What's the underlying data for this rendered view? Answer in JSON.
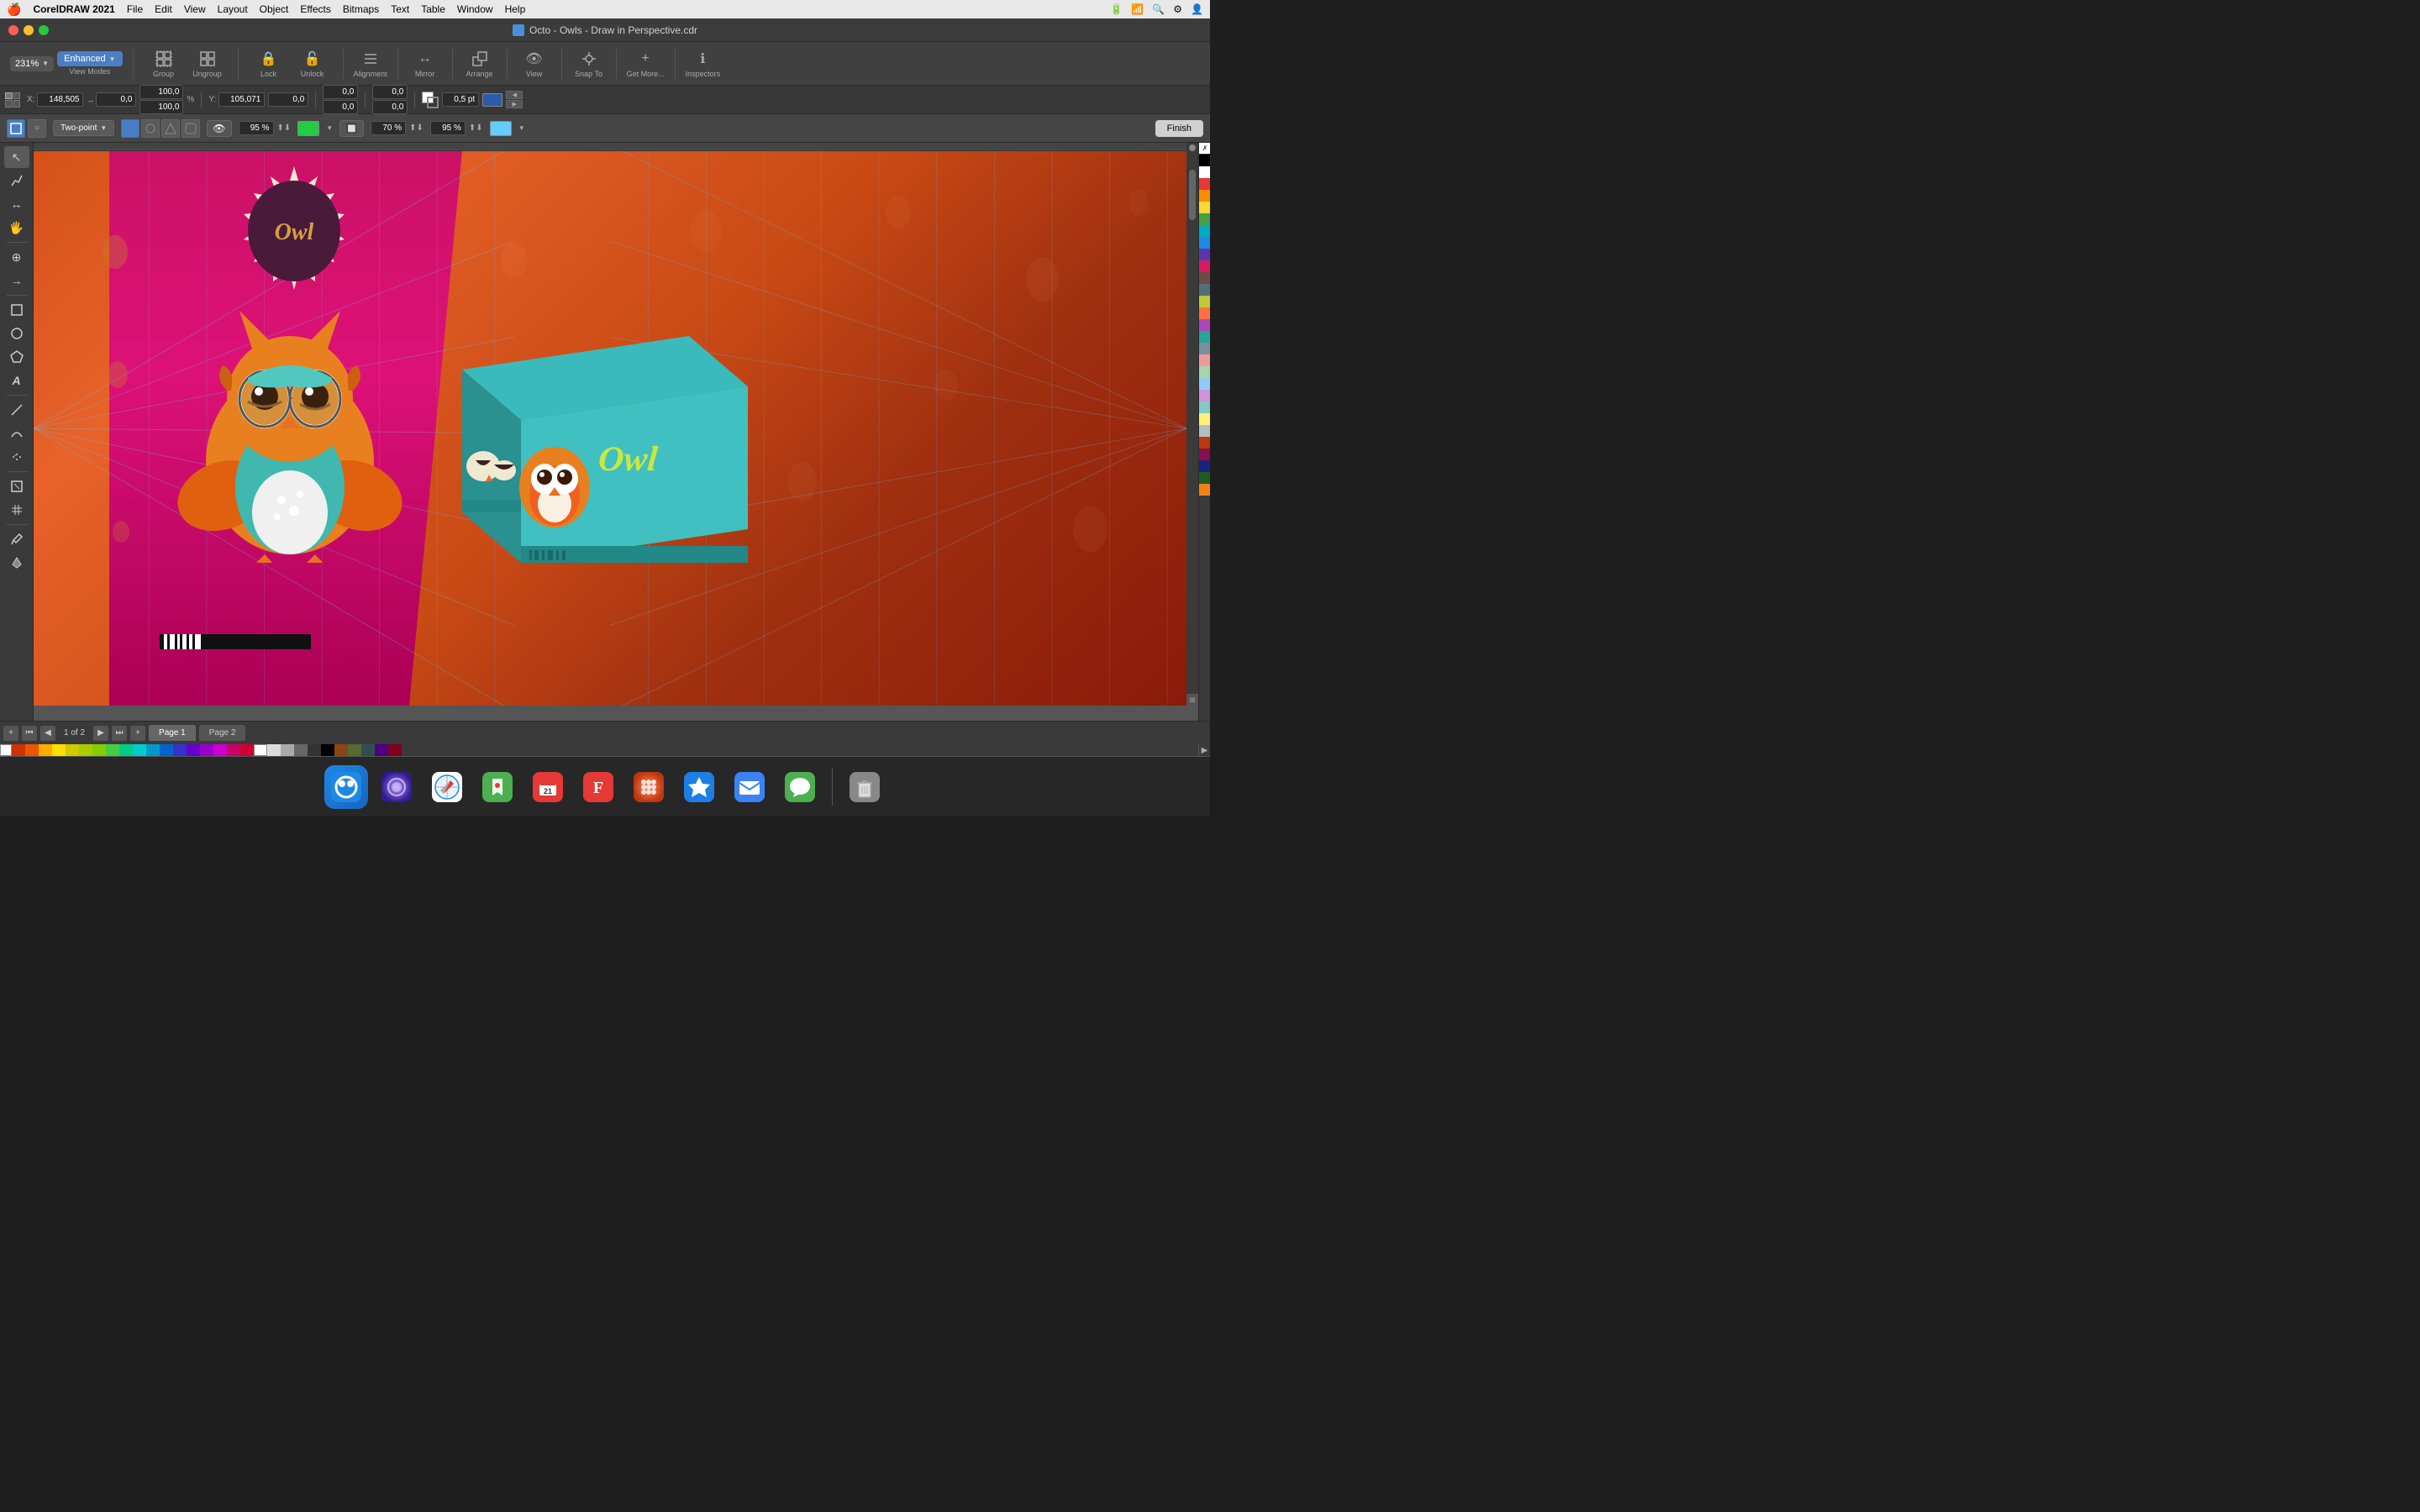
{
  "menubar": {
    "apple": "🍎",
    "appName": "CorelDRAW 2021",
    "menus": [
      "File",
      "Edit",
      "View",
      "Layout",
      "Object",
      "Effects",
      "Bitmaps",
      "Text",
      "Table",
      "Window",
      "Help"
    ],
    "rightItems": [
      "battery-icon",
      "wifi-icon",
      "search-icon",
      "control-icon",
      "user-icon"
    ]
  },
  "titlebar": {
    "title": "Octo - Owls - Draw in Perspective.cdr"
  },
  "toolbar": {
    "zoom": "231%",
    "viewModes": "Enhanced",
    "group": "Group",
    "ungroup": "Ungroup",
    "lock": "Lock",
    "unlock": "Unlock",
    "alignment": "Alignment",
    "mirror": "Mirror",
    "arrange": "Arrange",
    "view": "View",
    "snapTo": "Snap To",
    "getMore": "Get More...",
    "inspectors": "Inspectors"
  },
  "propertiesBar": {
    "xLabel": "X:",
    "xValue": "148,505",
    "yLabel": "Y:",
    "yValue": "105,071",
    "widthValue": "0,0",
    "heightValue": "0,0",
    "scaleW": "100,0",
    "scaleH": "100,0",
    "percentSymbol": "%",
    "posX": "0,0",
    "posY": "0,0",
    "rotX": "0,0",
    "rotY": "0,0",
    "strokeWidth": "0,5 pt"
  },
  "perspectiveBar": {
    "perspectiveType": "Two-point",
    "opacity1Label": "95 %",
    "opacity2Label": "70 %",
    "opacity3Label": "95 %",
    "finishBtn": "Finish"
  },
  "pageTabs": {
    "addPage": "+",
    "prevFirst": "⏮",
    "prev": "◀",
    "counter": "1 of 2",
    "next": "▶",
    "nextLast": "⏭",
    "addPageEnd": "+",
    "page1": "Page 1",
    "page2": "Page 2"
  },
  "colorPalette": {
    "colors": [
      "#cc3300",
      "#cc6600",
      "#cc9900",
      "#cccc00",
      "#99cc00",
      "#66cc00",
      "#33cc00",
      "#00cc00",
      "#00cc33",
      "#00cc66",
      "#00cc99",
      "#00cccc",
      "#0099cc",
      "#0066cc",
      "#0033cc",
      "#0000cc",
      "#3300cc",
      "#6600cc",
      "#9900cc",
      "#cc00cc",
      "#cc0099",
      "#cc0066",
      "#cc0033",
      "#ffffff",
      "#cccccc",
      "#999999",
      "#666666",
      "#333333",
      "#000000"
    ]
  },
  "colorStrip": {
    "colors": [
      "#cc3300",
      "#cc6600",
      "#ffaa00",
      "#ffcc00",
      "#cccc00",
      "#99cc00",
      "#66cc00",
      "#33cc00",
      "#00cc66",
      "#00cccc",
      "#0099cc",
      "#0066cc",
      "#3300cc",
      "#9900cc",
      "#cc00cc",
      "#cc0066",
      "#ffffff",
      "#e0e0e0",
      "#c0c0c0",
      "#888888",
      "#555555",
      "#222222",
      "#000000",
      "#cc3300",
      "#663300",
      "#336600",
      "#003366",
      "#330066",
      "#660033"
    ]
  },
  "dock": {
    "items": [
      {
        "name": "finder",
        "emoji": "🔍",
        "color": "#1e6fd9"
      },
      {
        "name": "siri",
        "emoji": "🔮",
        "color": "#5b4ee3"
      },
      {
        "name": "safari",
        "emoji": "🧭",
        "color": "#1e90ff"
      },
      {
        "name": "maps",
        "emoji": "🗺️",
        "color": "#4caf50"
      },
      {
        "name": "fantastical",
        "emoji": "📅",
        "color": "#e53935"
      },
      {
        "name": "fontbook",
        "emoji": "F",
        "color": "#e53935"
      },
      {
        "name": "launchpad",
        "emoji": "🚀",
        "color": "#ff6b35"
      },
      {
        "name": "appstore",
        "emoji": "🏪",
        "color": "#1d7fe5"
      },
      {
        "name": "mail",
        "emoji": "✉️",
        "color": "#3b82f6"
      },
      {
        "name": "messages",
        "emoji": "💬",
        "color": "#4caf50"
      },
      {
        "name": "trash",
        "emoji": "🗑️",
        "color": "#888"
      }
    ]
  },
  "tools": {
    "items": [
      "↖",
      "✏",
      "↔",
      "🖐",
      "⊕",
      "→",
      "□",
      "○",
      "⬡",
      "A",
      "/",
      "~",
      "☁",
      "□",
      "▦"
    ]
  }
}
